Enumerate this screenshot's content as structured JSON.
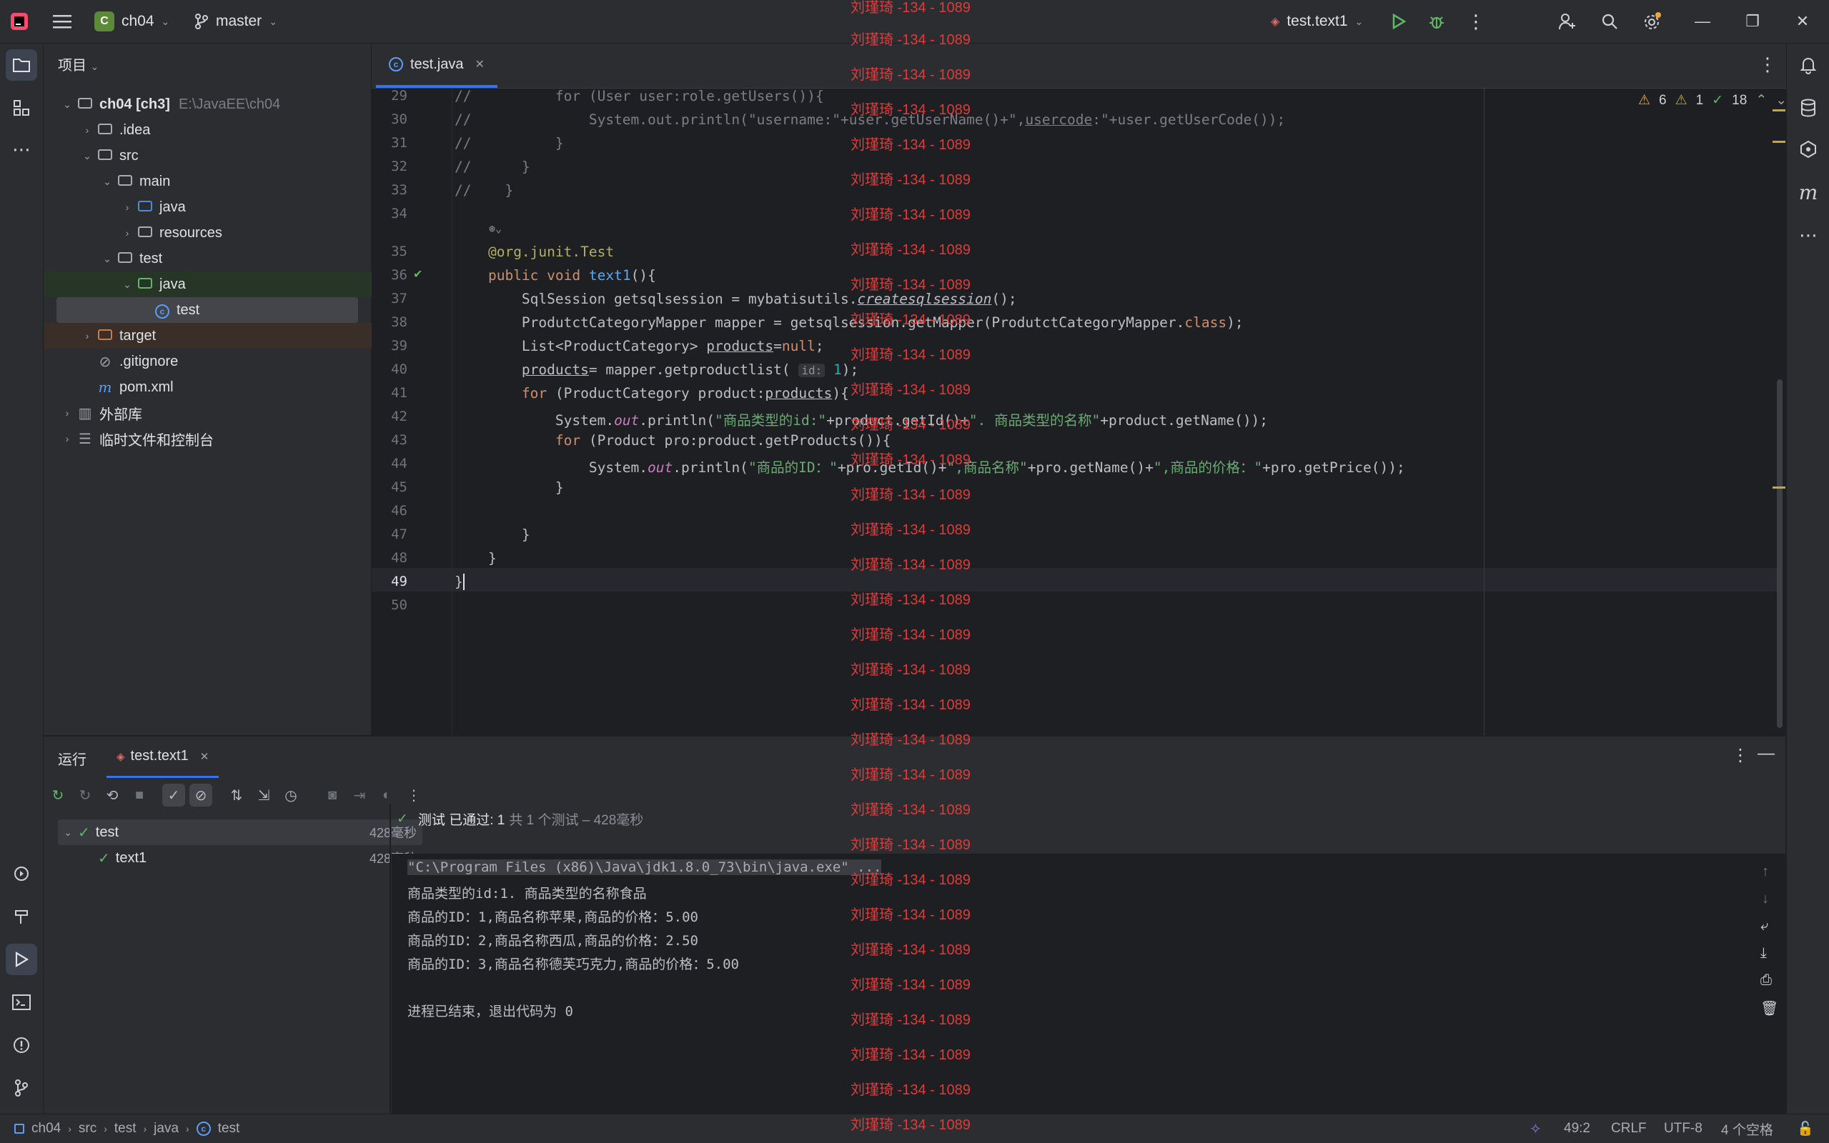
{
  "titlebar": {
    "project_badge": "C",
    "project_name": "ch04",
    "branch": "master",
    "run_config": "test.text1"
  },
  "project_panel": {
    "title": "项目",
    "tree": [
      {
        "label": "ch04 [ch3]",
        "hint": "E:\\JavaEE\\ch04"
      },
      {
        "label": ".idea"
      },
      {
        "label": "src"
      },
      {
        "label": "main"
      },
      {
        "label": "java"
      },
      {
        "label": "resources"
      },
      {
        "label": "test"
      },
      {
        "label": "java"
      },
      {
        "label": "test"
      },
      {
        "label": "target"
      },
      {
        "label": ".gitignore"
      },
      {
        "label": "pom.xml"
      },
      {
        "label": "外部库"
      },
      {
        "label": "临时文件和控制台"
      }
    ]
  },
  "editor": {
    "tab": "test.java",
    "inspections": {
      "warnings": "6",
      "weak": "1",
      "ok": "18"
    },
    "line_numbers": [
      "29",
      "30",
      "31",
      "32",
      "33",
      "34",
      "35",
      "36",
      "37",
      "38",
      "39",
      "40",
      "41",
      "42",
      "43",
      "44",
      "45",
      "46",
      "47",
      "48",
      "49",
      "50"
    ]
  },
  "run_panel": {
    "title": "运行",
    "tab": "test.text1",
    "tests": [
      {
        "name": "test",
        "duration": "428毫秒"
      },
      {
        "name": "text1",
        "duration": "428毫秒"
      }
    ],
    "summary": "测试 已通过: 1",
    "summary_detail": "共 1 个测试 – 428毫秒",
    "console": [
      "\"C:\\Program Files (x86)\\Java\\jdk1.8.0_73\\bin\\java.exe\" ...",
      "商品类型的id:1. 商品类型的名称食品",
      "商品的ID：1,商品名称苹果,商品的价格：5.00",
      "商品的ID：2,商品名称西瓜,商品的价格：2.50",
      "商品的ID：3,商品名称德芙巧克力,商品的价格：5.00",
      "",
      "进程已结束，退出代码为 0"
    ]
  },
  "statusbar": {
    "breadcrumb": [
      "ch04",
      "src",
      "test",
      "java",
      "test"
    ],
    "position": "49:2",
    "line_sep": "CRLF",
    "encoding": "UTF-8",
    "indent": "4 个空格"
  },
  "watermark": "刘瑾琦 -134 - 1089"
}
